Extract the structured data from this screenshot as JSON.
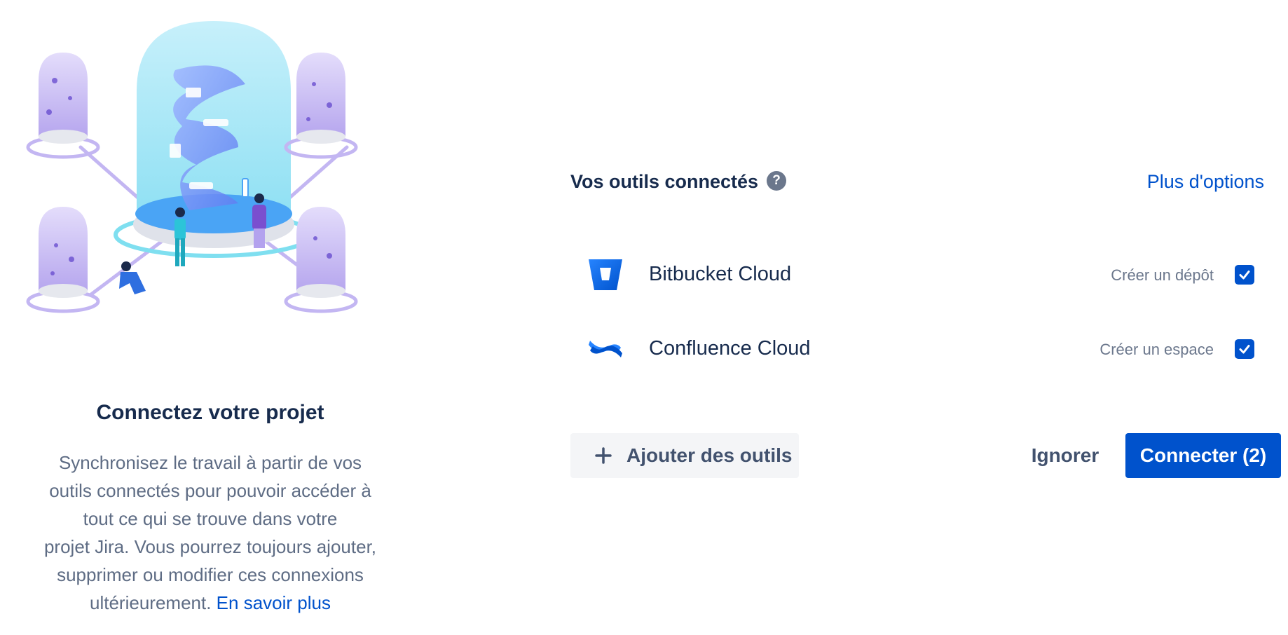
{
  "intro": {
    "title": "Connectez votre projet",
    "description_lines": [
      "Synchronisez le travail à partir de vos",
      "outils connectés pour pouvoir accéder à",
      "tout ce qui se trouve dans votre",
      "projet Jira. Vous pourrez toujours ajouter,",
      "supprimer ou modifier ces connexions",
      "ultérieurement."
    ],
    "learn_more": "En savoir plus"
  },
  "tools_panel": {
    "title": "Vos outils connectés",
    "help_icon": "?",
    "more_options": "Plus d'options",
    "tools": [
      {
        "name": "Bitbucket Cloud",
        "action": "Créer un dépôt",
        "checked": true,
        "icon": "bitbucket-icon"
      },
      {
        "name": "Confluence Cloud",
        "action": "Créer un espace",
        "checked": true,
        "icon": "confluence-icon"
      }
    ]
  },
  "footer": {
    "add_tools": "Ajouter des outils",
    "ignore": "Ignorer",
    "connect": "Connecter (2)"
  },
  "colors": {
    "primary": "#0052cc",
    "text_dark": "#172b4d",
    "text_muted": "#5e6c84"
  }
}
